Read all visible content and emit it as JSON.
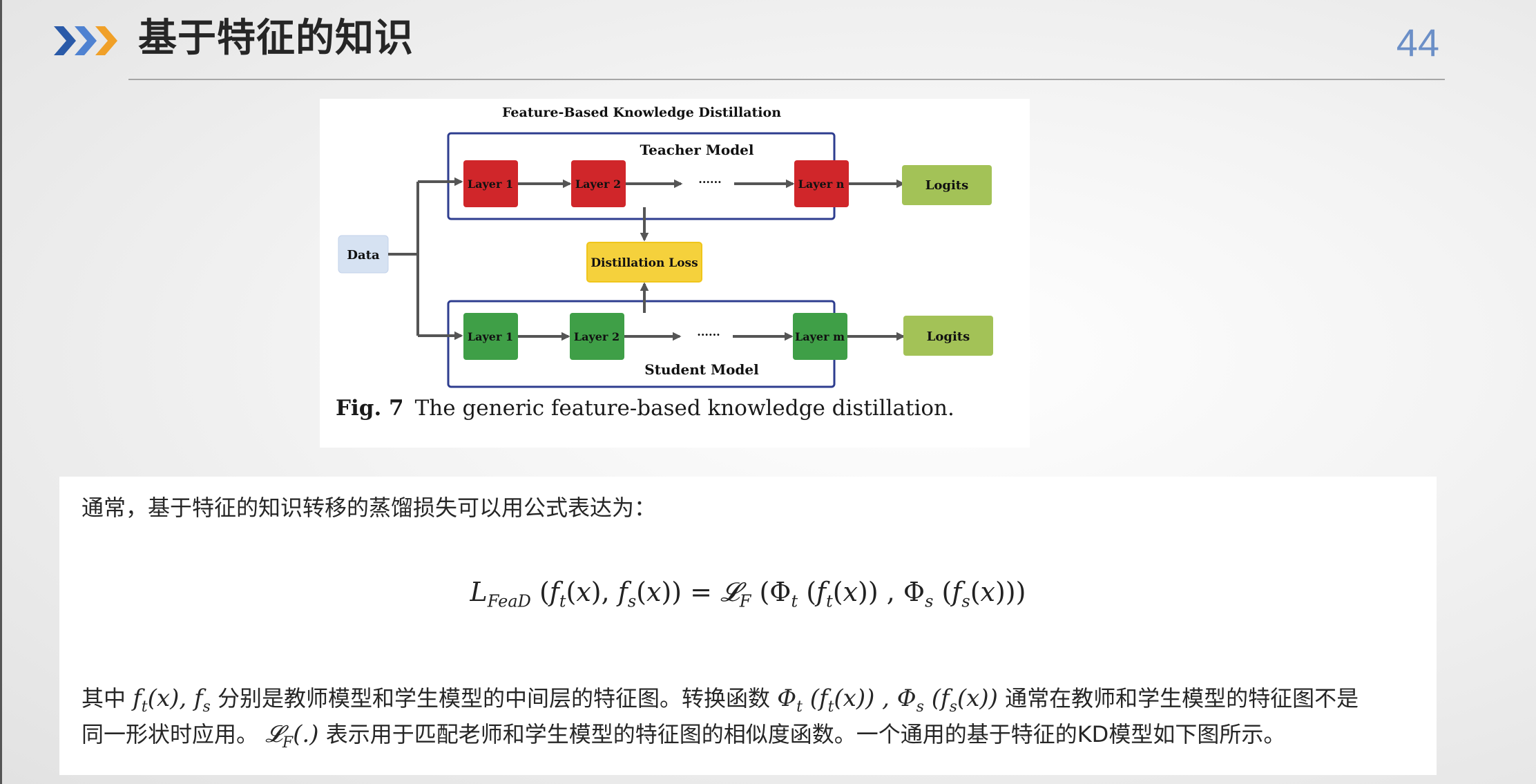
{
  "header": {
    "title": "基于特征的知识",
    "page_number": "44",
    "chevron_colors": [
      "#2a5aa8",
      "#4f82d1",
      "#f0a028"
    ]
  },
  "figure": {
    "diagram_title": "Feature-Based Knowledge Distillation",
    "teacher_model_label": "Teacher Model",
    "student_model_label": "Student Model",
    "data_label": "Data",
    "distillation_loss_label": "Distillation Loss",
    "teacher_layers": [
      "Layer 1",
      "Layer 2",
      "Layer n"
    ],
    "student_layers": [
      "Layer 1",
      "Layer 2",
      "Layer m"
    ],
    "ellipsis": "······",
    "logits_label": "Logits",
    "caption_prefix": "Fig. 7",
    "caption_text": "The generic feature-based knowledge distillation.",
    "colors": {
      "teacher_layer": "#d0262a",
      "student_layer": "#3f9f47",
      "logits": "#a3c257",
      "loss": "#f5d13c",
      "data": "#d6e2f2",
      "frame": "#2e3d8f",
      "arrow": "#555555"
    }
  },
  "text": {
    "intro": "通常，基于特征的知识转移的蒸馏损失可以用公式表达为：",
    "formula": "L_FeaD(f_t(x), f_s(x)) = 𝓛_F(Φ_t(f_t(x)), Φ_s(f_s(x)))",
    "line1_a": "其中",
    "line1_b": "分别是教师模型和学生模型的中间层的特征图。转换函数",
    "line1_c": "通常在教师和学生模型的特征图不是",
    "line2_a": "同一形状时应用。",
    "line2_b": "表示用于匹配老师和学生模型的特征图的相似度函数。一个通用的基于特征的KD模型如下图所示。"
  }
}
